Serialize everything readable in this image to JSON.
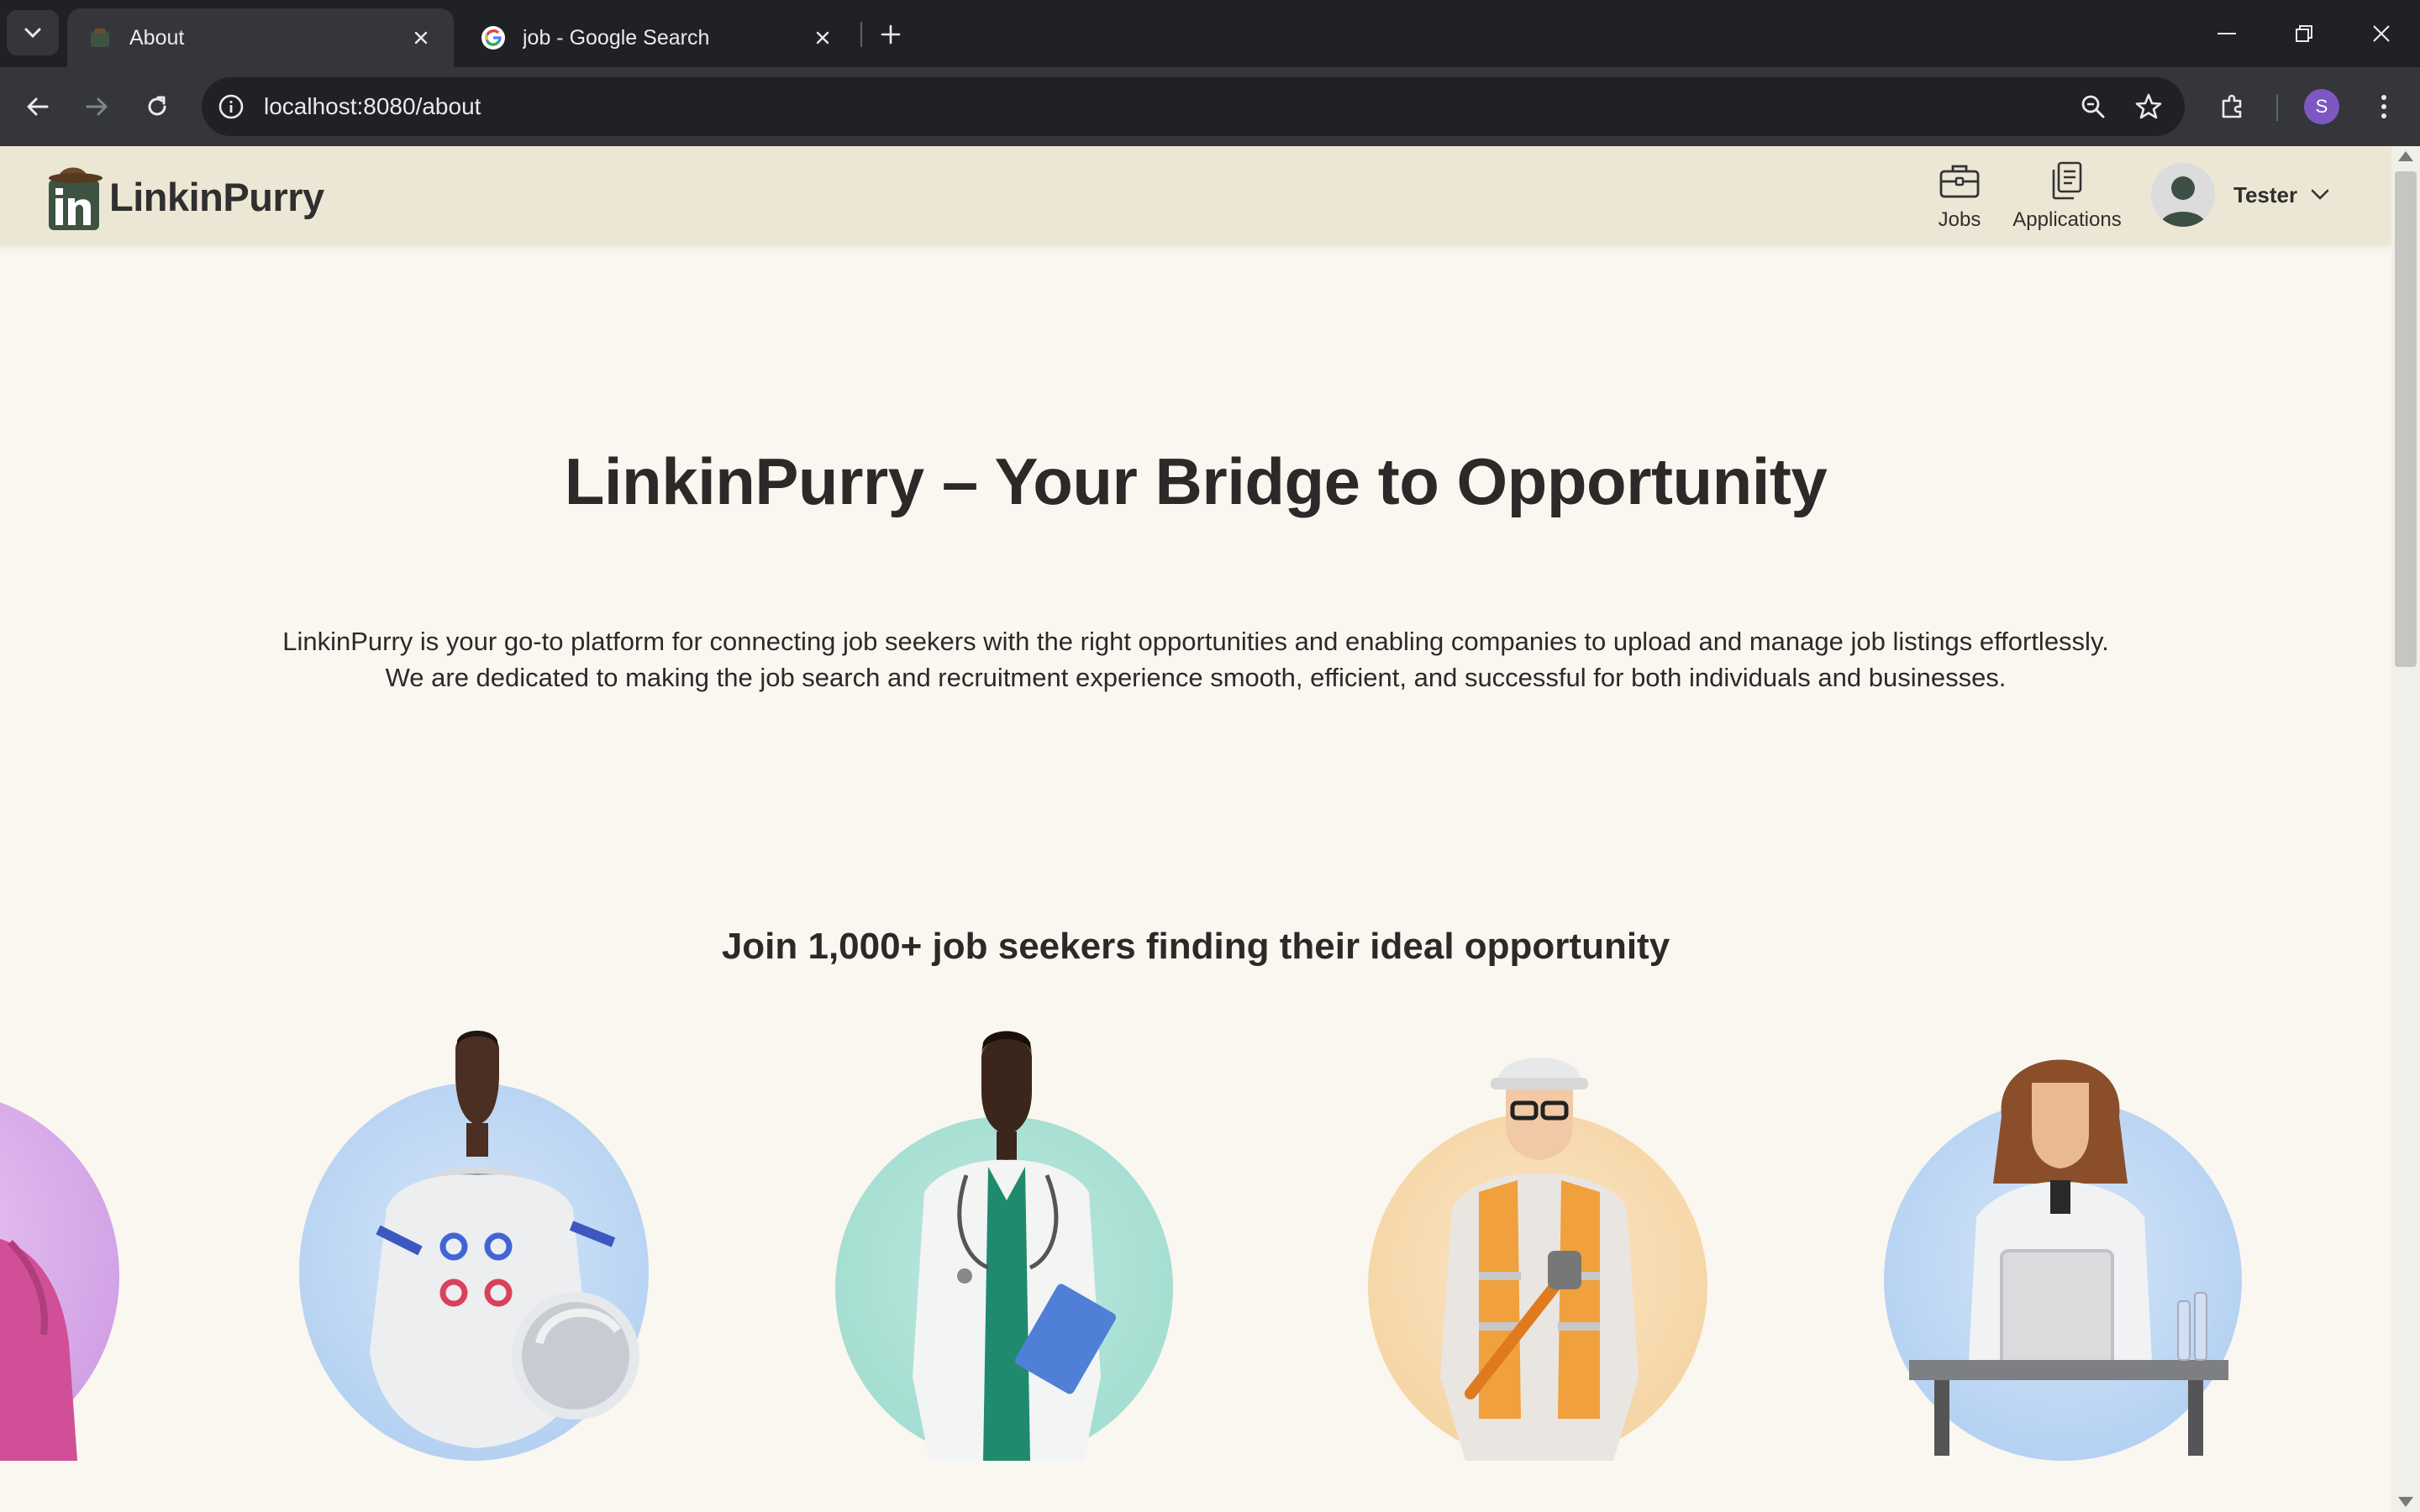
{
  "browser": {
    "tabs": [
      {
        "title": "About",
        "active": true
      },
      {
        "title": "job - Google Search",
        "active": false
      }
    ],
    "url": "localhost:8080/about",
    "profile_initial": "S"
  },
  "site": {
    "brand": "LinkinPurry",
    "nav": [
      {
        "label": "Jobs",
        "icon": "briefcase-icon"
      },
      {
        "label": "Applications",
        "icon": "documents-icon"
      }
    ],
    "user": {
      "name": "Tester"
    }
  },
  "hero": {
    "title": "LinkinPurry – Your Bridge to Opportunity",
    "description_line1": "LinkinPurry is your go-to platform for connecting job seekers with the right opportunities and enabling companies to upload and manage job listings effortlessly.",
    "description_line2": "We are dedicated to making the job search and recruitment experience smooth, efficient, and successful for both individuals and businesses."
  },
  "join": {
    "title": "Join 1,000+ job seekers finding their ideal opportunity"
  },
  "personas": [
    {
      "role": "casual-worker",
      "bg": "#d9a8ea"
    },
    {
      "role": "astronaut",
      "bg": "#b9d6f4"
    },
    {
      "role": "doctor",
      "bg": "#a9dfd4"
    },
    {
      "role": "construction-worker",
      "bg": "#f6d9ae"
    },
    {
      "role": "lab-scientist",
      "bg": "#b9d6f4"
    }
  ],
  "colors": {
    "header_bg": "#ece6d4",
    "page_bg": "#faf7f0",
    "text": "#2b2a29",
    "chrome_dark": "#202124",
    "chrome_mid": "#35363a"
  }
}
